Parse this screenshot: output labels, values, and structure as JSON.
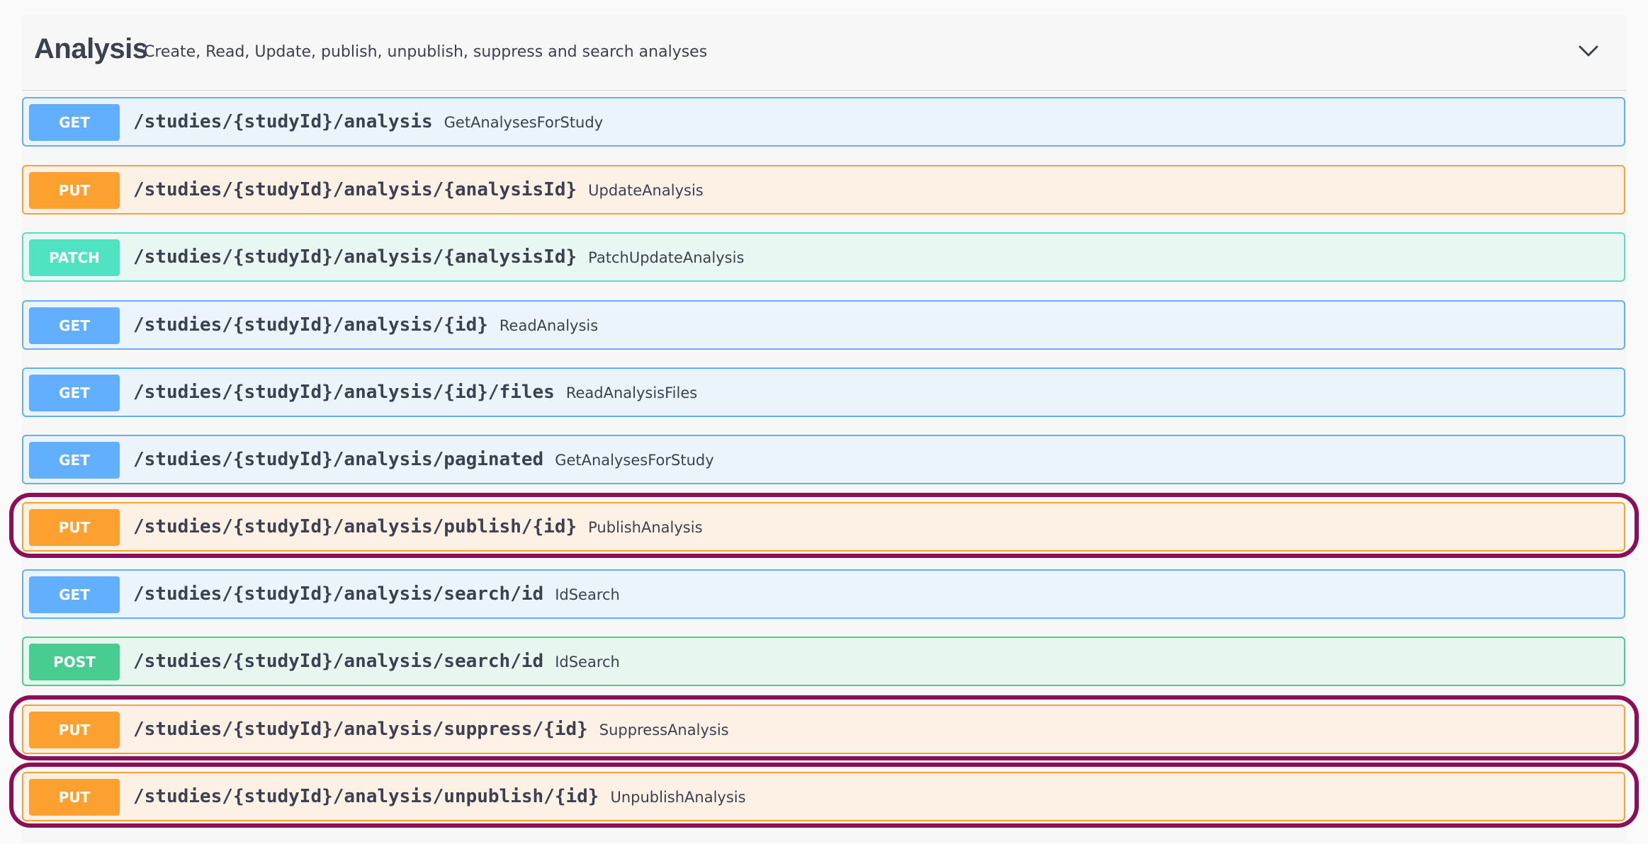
{
  "tag": {
    "name": "Analysis",
    "description": "Create, Read, Update, publish, unpublish, suppress and search analyses",
    "toggle_icon": "chevron-down-icon"
  },
  "operations": [
    {
      "method": "GET",
      "path": "/studies/{studyId}/analysis",
      "summary": "GetAnalysesForStudy"
    },
    {
      "method": "PUT",
      "path": "/studies/{studyId}/analysis/{analysisId}",
      "summary": "UpdateAnalysis"
    },
    {
      "method": "PATCH",
      "path": "/studies/{studyId}/analysis/{analysisId}",
      "summary": "PatchUpdateAnalysis"
    },
    {
      "method": "GET",
      "path": "/studies/{studyId}/analysis/{id}",
      "summary": "ReadAnalysis"
    },
    {
      "method": "GET",
      "path": "/studies/{studyId}/analysis/{id}/files",
      "summary": "ReadAnalysisFiles"
    },
    {
      "method": "GET",
      "path": "/studies/{studyId}/analysis/paginated",
      "summary": "GetAnalysesForStudy"
    },
    {
      "method": "PUT",
      "path": "/studies/{studyId}/analysis/publish/{id}",
      "summary": "PublishAnalysis",
      "highlighted": true
    },
    {
      "method": "GET",
      "path": "/studies/{studyId}/analysis/search/id",
      "summary": "IdSearch"
    },
    {
      "method": "POST",
      "path": "/studies/{studyId}/analysis/search/id",
      "summary": "IdSearch"
    },
    {
      "method": "PUT",
      "path": "/studies/{studyId}/analysis/suppress/{id}",
      "summary": "SuppressAnalysis",
      "highlighted": true
    },
    {
      "method": "PUT",
      "path": "/studies/{studyId}/analysis/unpublish/{id}",
      "summary": "UnpublishAnalysis",
      "highlighted": true
    }
  ],
  "colors": {
    "get": "#61affe",
    "put": "#fca130",
    "patch": "#50e3c2",
    "post": "#49cc90",
    "highlight": "#8b0f57"
  }
}
